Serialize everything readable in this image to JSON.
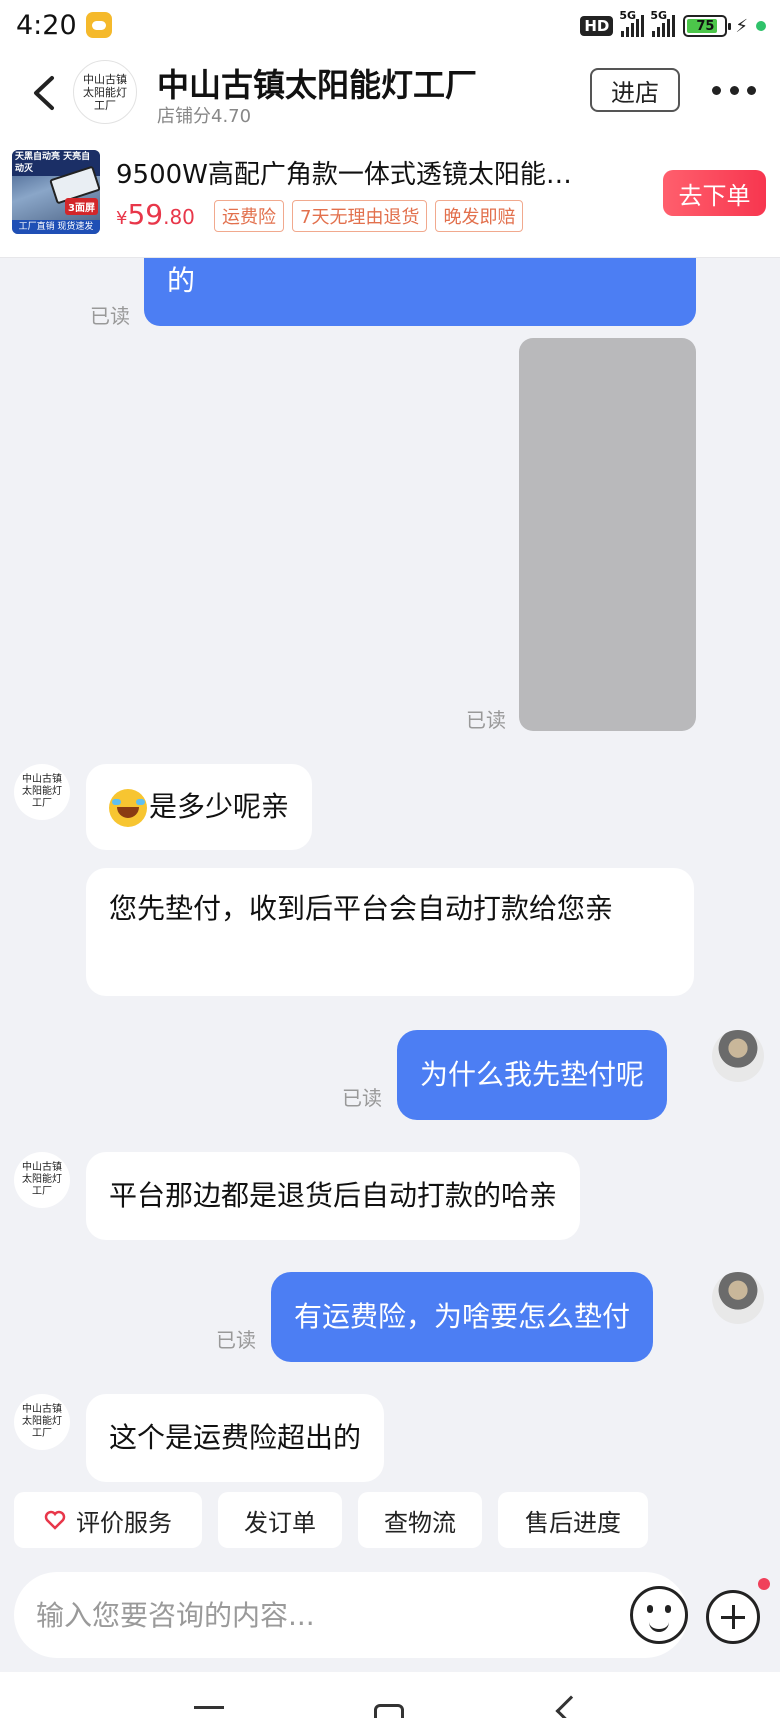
{
  "status_bar": {
    "time": "4:20",
    "network_hd": "HD",
    "network1": "5G",
    "network2": "5G",
    "battery": "75"
  },
  "header": {
    "shop_avatar_text": "中山古镇太阳能灯工厂",
    "shop_name": "中山古镇太阳能灯工厂",
    "shop_score": "店铺分4.70",
    "enter_label": "进店"
  },
  "product": {
    "thumb_top": "天黑自动亮 天亮自动灭",
    "thumb_tag": "3面屏",
    "thumb_bottom": "工厂直销 现货速发",
    "title": "9500W高配广角款一体式透镜太阳能…",
    "price_symbol": "¥",
    "price_int": "59",
    "price_dec": ".80",
    "badges": [
      "运费险",
      "7天无理由退货",
      "晚发即赔"
    ],
    "order_label": "去下单"
  },
  "messages": {
    "m1_text": "的",
    "m1_read": "已读",
    "m2_read": "已读",
    "m3_text": "是多少呢亲",
    "m4_text": "您先垫付，收到后平台会自动打款给您亲",
    "m5_text": "为什么我先垫付呢",
    "m5_read": "已读",
    "m6_text": "平台那边都是退货后自动打款的哈亲",
    "m7_text": "有运费险，为啥要怎么垫付",
    "m7_read": "已读",
    "m8_text": "这个是运费险超出的",
    "shop_avatar_small": "中山古镇太阳能灯工厂"
  },
  "quick_actions": [
    "评价服务",
    "发订单",
    "查物流",
    "售后进度"
  ],
  "input": {
    "placeholder": "输入您要咨询的内容..."
  },
  "colors": {
    "accent": "#4c7ef3",
    "price": "#e8374a",
    "order_button": "#f7364f",
    "background": "#f1f2f6"
  }
}
